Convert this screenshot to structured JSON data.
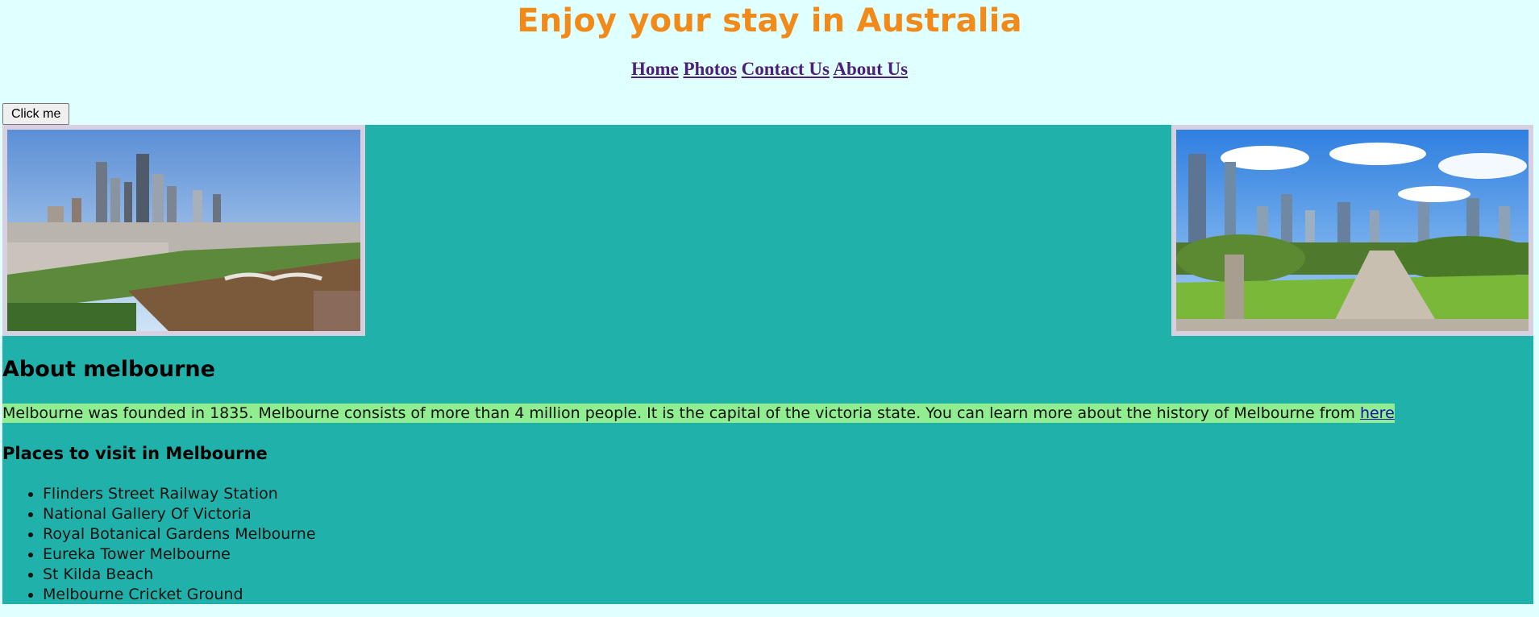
{
  "header": {
    "title": "Enjoy your stay in Australia",
    "nav": [
      "Home",
      "Photos",
      "Contact Us",
      "About Us"
    ]
  },
  "button": {
    "label": "Click me"
  },
  "about": {
    "heading": "About melbourne",
    "paragraph": "Melbourne was founded in 1835. Melbourne consists of more than 4 million people. It is the capital of the victoria state. You can learn more about the history of Melbourne from ",
    "link_text": "here"
  },
  "places": {
    "heading": "Places to visit in Melbourne",
    "items": [
      "Flinders Street Railway Station",
      "National Gallery Of Victoria",
      "Royal Botanical Gardens Melbourne",
      "Eureka Tower Melbourne",
      "St Kilda Beach",
      "Melbourne Cricket Ground"
    ]
  },
  "colors": {
    "page_bg": "#e0ffff",
    "title": "#f28a1a",
    "content_bg": "#20b2aa",
    "highlight": "#90ee90",
    "nav_link": "#4b1f7a"
  }
}
